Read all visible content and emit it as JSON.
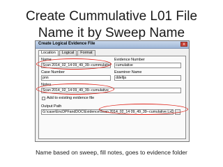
{
  "slide": {
    "title_line1": "Create Cummulative L01 File",
    "title_line2": "Name it by Sweep Name",
    "caption": "Name based on sweep, fill notes, goes to evidence folder"
  },
  "dialog": {
    "title": "Create Logical Evidence File",
    "close_glyph": "x",
    "tabs": [
      "Location",
      "Logical",
      "Format"
    ],
    "name_label": "Name",
    "name_value": "Scan 2014_02_14 09_49_39--cummulative",
    "evidence_number_label": "Evidence Number",
    "evidence_number_value": "cumulative",
    "case_number_label": "Case Number",
    "case_number_value": "pnn",
    "examiner_name_label": "Examiner Name",
    "examiner_name_value": "ddellja",
    "notes_label": "Notes",
    "notes_value": "Scan 2014_02_14 09_49_39--cumulative",
    "add_existing_label": "Add to existing evidence file",
    "output_path_label": "Output Path",
    "output_path_value": "G:\\case\\EncDPFandDOC\\Evidence\\Scan 2014_02_14 09_49_39--cumulative.Lx01",
    "browse_glyph": "..."
  },
  "annotation_color": "#e0281e"
}
